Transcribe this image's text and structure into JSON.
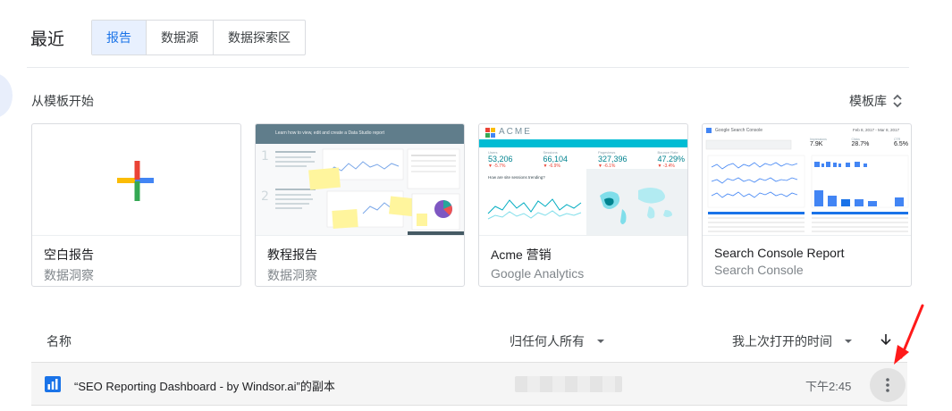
{
  "header": {
    "title": "最近",
    "tabs": [
      {
        "label": "报告",
        "active": true
      },
      {
        "label": "数据源",
        "active": false
      },
      {
        "label": "数据探索区",
        "active": false
      }
    ]
  },
  "templates": {
    "section_title": "从模板开始",
    "library_label": "模板库",
    "cards": [
      {
        "name": "空白报告",
        "source": "数据洞察"
      },
      {
        "name": "教程报告",
        "source": "数据洞察",
        "preview_heading": "Learn how to view, edit and create a Data Studio report"
      },
      {
        "name": "Acme 营销",
        "source": "Google Analytics",
        "preview_brand": "ACME",
        "preview_metrics": [
          {
            "label": "Users",
            "value": "53,206"
          },
          {
            "label": "Sessions",
            "value": "66,104"
          },
          {
            "label": "Pageviews",
            "value": "327,396"
          },
          {
            "label": "Bounce Rate",
            "value": "47.29%"
          }
        ],
        "preview_chart_titles": [
          "How are site sessions trending?",
          "What are the top countries by sessions?"
        ]
      },
      {
        "name": "Search Console Report",
        "source": "Search Console",
        "preview_brand": "Google Search Console",
        "preview_dates": "Feb 8, 2017 - Mar 8, 2017",
        "preview_metrics": [
          {
            "label": "Impressions",
            "value": "7.9K"
          },
          {
            "label": "Clicks",
            "value": "28.7%"
          },
          {
            "label": "CTR",
            "value": "6.5%"
          }
        ]
      }
    ]
  },
  "list": {
    "columns": {
      "name": "名称",
      "owner": "归任何人所有",
      "last_opened": "我上次打开的时间"
    },
    "rows": [
      {
        "title": "“SEO Reporting Dashboard - by Windsor.ai”的副本",
        "time": "下午2:45"
      }
    ]
  },
  "colors": {
    "accent": "#1a73e8",
    "active_tab_bg": "#e8f0fe",
    "acme_teal": "#00bcd4",
    "arrow_red": "#ea4335"
  }
}
